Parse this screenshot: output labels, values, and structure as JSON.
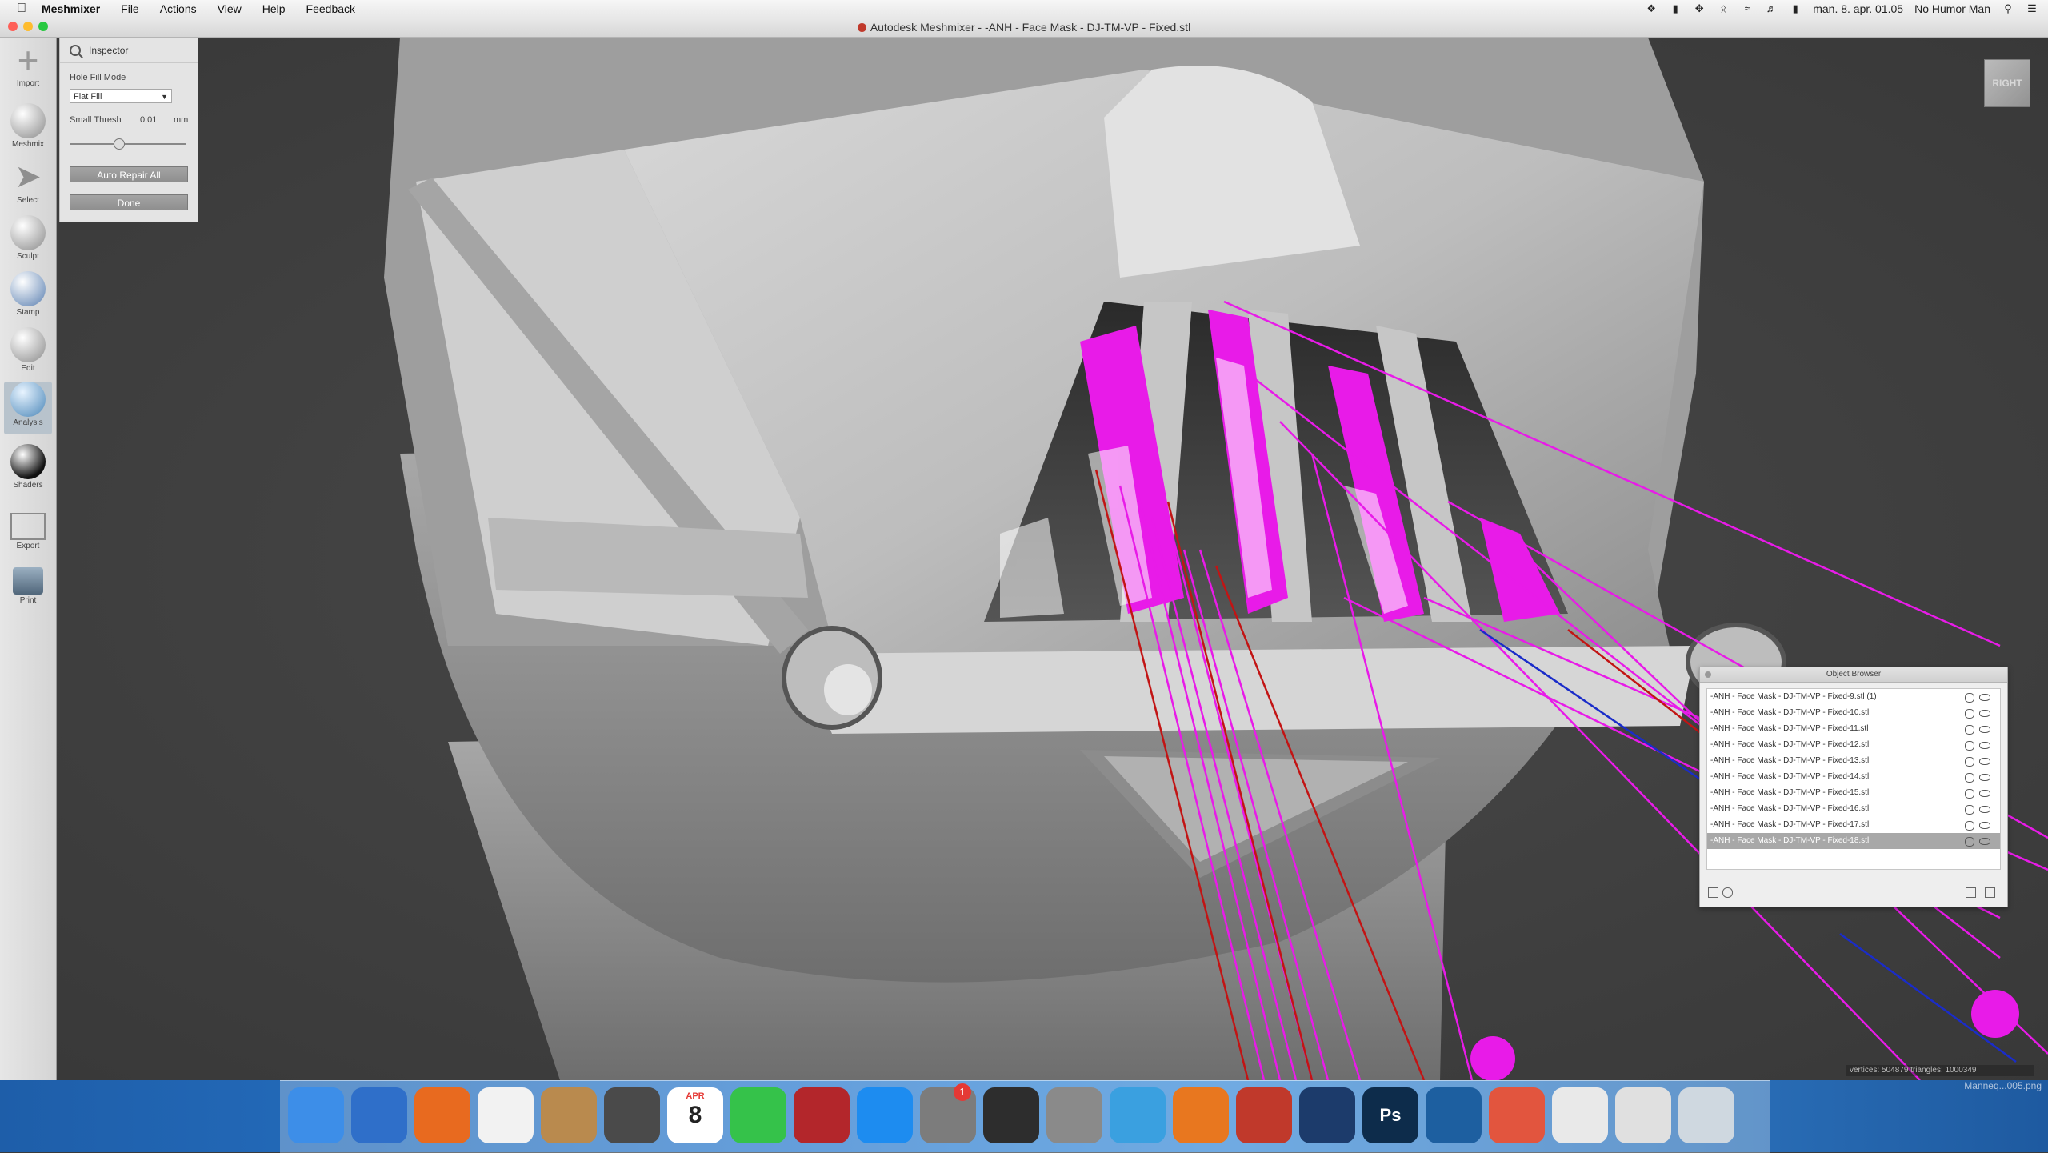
{
  "menubar": {
    "app_name": "Meshmixer",
    "menus": [
      "File",
      "Actions",
      "View",
      "Help",
      "Feedback"
    ],
    "datetime": "man. 8. apr. 01.05",
    "user": "No Humor Man"
  },
  "window": {
    "title": "Autodesk Meshmixer - -ANH - Face Mask - DJ-TM-VP - Fixed.stl"
  },
  "toolbar": {
    "tools": [
      {
        "label": "Import",
        "icon": "plus-icon"
      },
      {
        "label": "Meshmix",
        "icon": "meshmix-icon"
      },
      {
        "label": "Select",
        "icon": "select-arrow-icon"
      },
      {
        "label": "Sculpt",
        "icon": "brush-icon"
      },
      {
        "label": "Stamp",
        "icon": "stamp-icon"
      },
      {
        "label": "Edit",
        "icon": "edit-icon"
      },
      {
        "label": "Analysis",
        "icon": "analysis-icon"
      },
      {
        "label": "Shaders",
        "icon": "shader-sphere-icon"
      },
      {
        "label": "Export",
        "icon": "export-icon"
      },
      {
        "label": "Print",
        "icon": "print-icon"
      }
    ],
    "active": "Analysis"
  },
  "inspector": {
    "title": "Inspector",
    "hole_fill_label": "Hole Fill Mode",
    "hole_fill_value": "Flat Fill",
    "small_thresh_label": "Small Thresh",
    "small_thresh_value": "0.01",
    "small_thresh_unit": "mm",
    "small_thresh_slider_fraction": 0.42,
    "auto_repair_label": "Auto Repair All",
    "done_label": "Done"
  },
  "navcube": {
    "face": "RIGHT"
  },
  "object_browser": {
    "title": "Object Browser",
    "items": [
      "-ANH - Face Mask - DJ-TM-VP - Fixed-9.stl (1)",
      "-ANH - Face Mask - DJ-TM-VP - Fixed-10.stl",
      "-ANH - Face Mask - DJ-TM-VP - Fixed-11.stl",
      "-ANH - Face Mask - DJ-TM-VP - Fixed-12.stl",
      "-ANH - Face Mask - DJ-TM-VP - Fixed-13.stl",
      "-ANH - Face Mask - DJ-TM-VP - Fixed-14.stl",
      "-ANH - Face Mask - DJ-TM-VP - Fixed-15.stl",
      "-ANH - Face Mask - DJ-TM-VP - Fixed-16.stl",
      "-ANH - Face Mask - DJ-TM-VP - Fixed-17.stl",
      "-ANH - Face Mask - DJ-TM-VP - Fixed-18.stl"
    ],
    "selected_index": 9
  },
  "status": {
    "stats": "vertices: 504879 triangles: 1000349",
    "desktop_file": "Manneq...005.png"
  },
  "dock": {
    "items": [
      {
        "name": "finder",
        "icon": "finder-icon",
        "color": "#3d8ee8"
      },
      {
        "name": "thunderbird",
        "icon": "thunderbird-icon",
        "color": "#2f6fc9"
      },
      {
        "name": "firefox",
        "icon": "firefox-icon",
        "color": "#e86a1f"
      },
      {
        "name": "textedit",
        "icon": "document-icon",
        "color": "#f2f2f2"
      },
      {
        "name": "contacts",
        "icon": "contacts-icon",
        "color": "#b98a4e"
      },
      {
        "name": "imovie",
        "icon": "star-icon",
        "color": "#4a4a4a"
      },
      {
        "name": "calendar",
        "icon": "calendar-icon",
        "color": "#ffffff",
        "text": "8",
        "sub": "APR"
      },
      {
        "name": "facetime",
        "icon": "facetime-icon",
        "color": "#35c24a"
      },
      {
        "name": "photo-booth",
        "icon": "photobooth-icon",
        "color": "#b3262b"
      },
      {
        "name": "app-store",
        "icon": "app-store-icon",
        "color": "#1d8cf0"
      },
      {
        "name": "system-preferences",
        "icon": "gear-icon",
        "color": "#7c7c7c"
      },
      {
        "name": "activity",
        "icon": "monitor-icon",
        "color": "#2d2d2d"
      },
      {
        "name": "launchpad",
        "icon": "rocket-icon",
        "color": "#8a8a8a"
      },
      {
        "name": "meshmixer",
        "icon": "meshmixer-dock-icon",
        "color": "#3aa0e0"
      },
      {
        "name": "blender",
        "icon": "blender-icon",
        "color": "#e8771f"
      },
      {
        "name": "fusion",
        "icon": "gem-icon",
        "color": "#c0392b"
      },
      {
        "name": "cinema4d",
        "icon": "c4d-icon",
        "color": "#1c3b6b"
      },
      {
        "name": "photoshop",
        "icon": "photoshop-icon",
        "color": "#0d2c4b",
        "text": "Ps"
      },
      {
        "name": "quicktime",
        "icon": "quicktime-icon",
        "color": "#1d5fa0"
      },
      {
        "name": "peach",
        "icon": "peach-icon",
        "color": "#e2553e"
      },
      {
        "name": "document-stack-1",
        "icon": "document-stack-icon",
        "color": "#e9e9e9"
      },
      {
        "name": "document-stack-2",
        "icon": "document-stack-icon",
        "color": "#e0e0e0"
      },
      {
        "name": "trash",
        "icon": "trash-icon",
        "color": "#cfd8e0"
      }
    ],
    "badge": "1"
  }
}
